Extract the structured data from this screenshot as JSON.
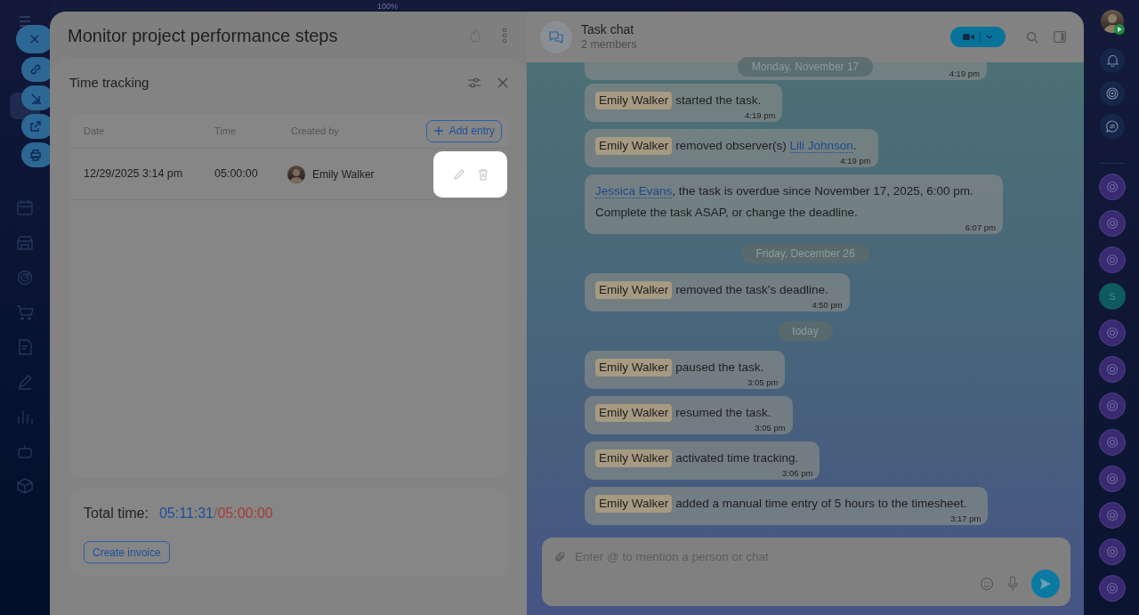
{
  "top_bar": {
    "zoom": "100%"
  },
  "right_sidebar": {
    "items": [
      {
        "kind": "chat"
      },
      {
        "kind": "chat"
      },
      {
        "kind": "chat"
      },
      {
        "kind": "letter",
        "text": "S"
      },
      {
        "kind": "chat"
      },
      {
        "kind": "chat"
      },
      {
        "kind": "chat"
      },
      {
        "kind": "chat"
      },
      {
        "kind": "chat"
      },
      {
        "kind": "chat"
      },
      {
        "kind": "chat"
      },
      {
        "kind": "chat"
      }
    ]
  },
  "task": {
    "title": "Monitor project performance steps"
  },
  "time_tracking": {
    "title": "Time tracking",
    "table": {
      "columns": [
        "Date",
        "Time",
        "Created by"
      ],
      "add_button": "Add entry",
      "rows": [
        {
          "date": "12/29/2025 3:14 pm",
          "time": "05:00:00",
          "created_by": "Emily Walker",
          "actions_highlighted": true
        }
      ]
    },
    "total": {
      "label": "Total time:",
      "spent": "05:11:31",
      "separator": "/",
      "planned": "05:00:00"
    },
    "invoice_button": "Create invoice"
  },
  "chat": {
    "title": "Task chat",
    "members": "2 members",
    "messages": [
      {
        "kind": "clipped",
        "time": "4:19 pm"
      },
      {
        "kind": "date",
        "text": "Monday, November 17"
      },
      {
        "kind": "event",
        "author": "Emily Walker",
        "parts": [
          {
            "text": " started the task."
          }
        ],
        "time": "4:19 pm"
      },
      {
        "kind": "event",
        "author": "Emily Walker",
        "parts": [
          {
            "text": " removed observer(s) "
          },
          {
            "link": "Lili Johnson"
          },
          {
            "text": "."
          }
        ],
        "time": "4:19 pm"
      },
      {
        "kind": "notice",
        "parts": [
          {
            "link": "Jessica Evans"
          },
          {
            "text": ", the task is overdue since November 17, 2025, 6:00 pm. Complete the task ASAP, or change the deadline."
          }
        ],
        "time": "6:07 pm"
      },
      {
        "kind": "date",
        "text": "Friday, December 26"
      },
      {
        "kind": "event",
        "author": "Emily Walker",
        "parts": [
          {
            "text": " removed the task's deadline."
          }
        ],
        "time": "4:50 pm"
      },
      {
        "kind": "date",
        "text": "today"
      },
      {
        "kind": "event",
        "author": "Emily Walker",
        "parts": [
          {
            "text": " paused the task."
          }
        ],
        "time": "3:05 pm"
      },
      {
        "kind": "event",
        "author": "Emily Walker",
        "parts": [
          {
            "text": " resumed the task."
          }
        ],
        "time": "3:05 pm"
      },
      {
        "kind": "event",
        "author": "Emily Walker",
        "parts": [
          {
            "text": " activated time tracking."
          }
        ],
        "time": "3:06 pm"
      },
      {
        "kind": "event",
        "author": "Emily Walker",
        "parts": [
          {
            "text": " added a manual time entry of 5 hours to the timesheet."
          }
        ],
        "time": "3:17 pm"
      }
    ],
    "input": {
      "placeholder": "Enter @ to mention a person or chat"
    }
  }
}
